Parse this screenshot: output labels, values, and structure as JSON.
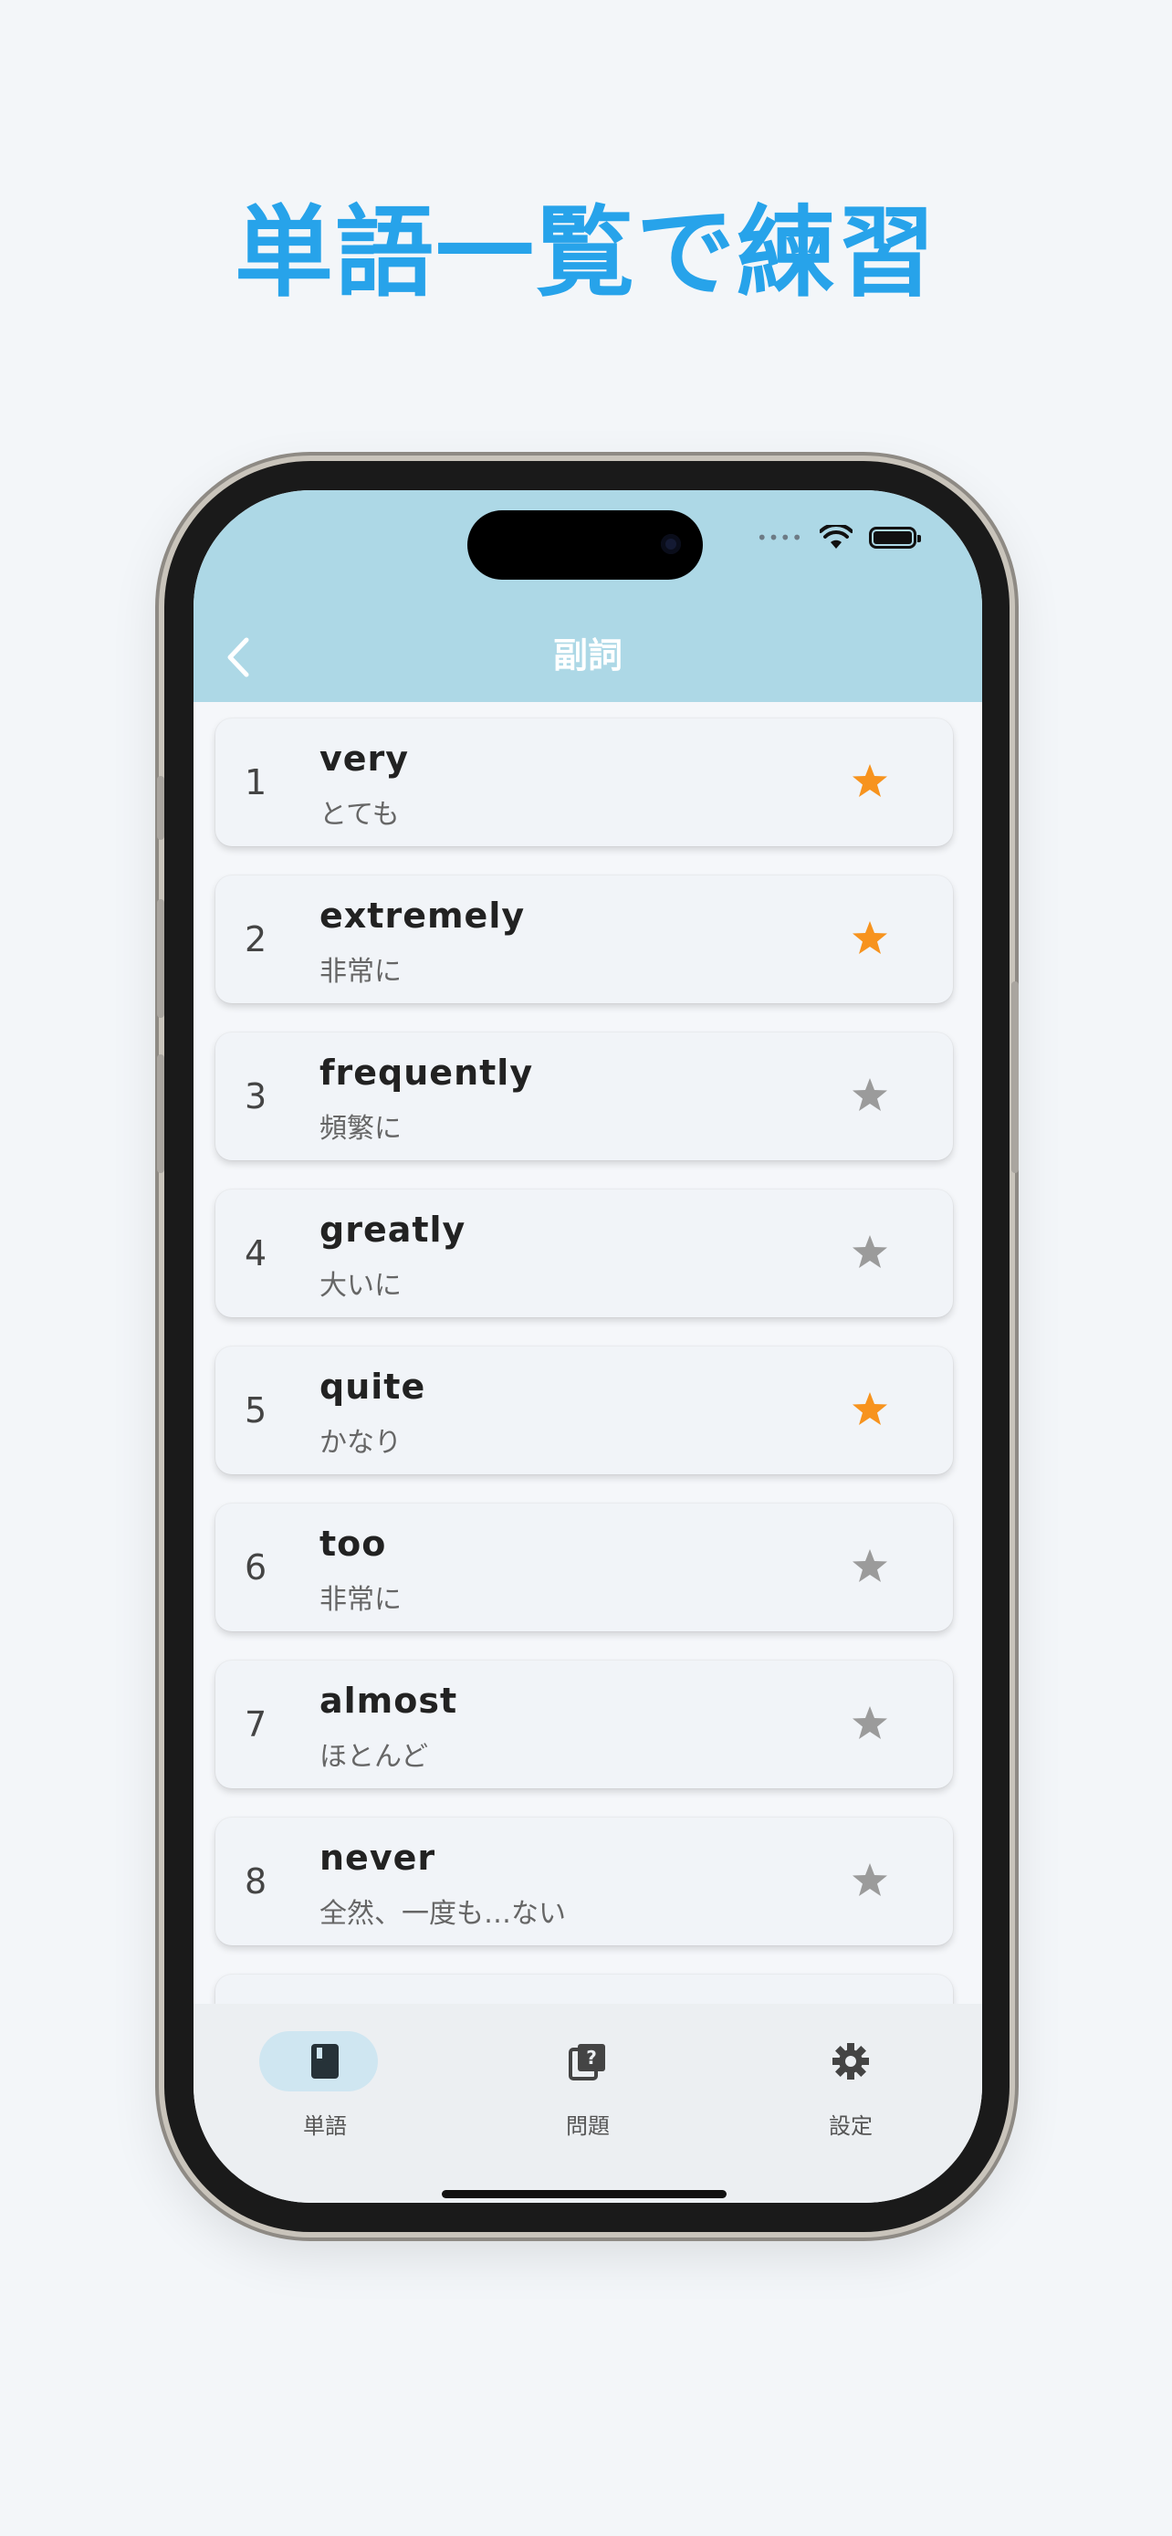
{
  "headline": "単語一覧で練習",
  "nav": {
    "title": "副詞"
  },
  "words": [
    {
      "num": "1",
      "word": "very",
      "meaning": "とても",
      "starred": true
    },
    {
      "num": "2",
      "word": "extremely",
      "meaning": "非常に",
      "starred": true
    },
    {
      "num": "3",
      "word": "frequently",
      "meaning": "頻繁に",
      "starred": false
    },
    {
      "num": "4",
      "word": "greatly",
      "meaning": "大いに",
      "starred": false
    },
    {
      "num": "5",
      "word": "quite",
      "meaning": "かなり",
      "starred": true
    },
    {
      "num": "6",
      "word": "too",
      "meaning": "非常に",
      "starred": false
    },
    {
      "num": "7",
      "word": "almost",
      "meaning": "ほとんど",
      "starred": false
    },
    {
      "num": "8",
      "word": "never",
      "meaning": "全然、一度も…ない",
      "starred": false
    }
  ],
  "tabs": [
    {
      "label": "単語",
      "icon": "book-icon",
      "active": true
    },
    {
      "label": "問題",
      "icon": "quiz-icon",
      "active": false
    },
    {
      "label": "設定",
      "icon": "gear-icon",
      "active": false
    }
  ],
  "colors": {
    "accent": "#27a3ea",
    "header": "#add8e6",
    "star_on": "#f7931e",
    "star_off": "#9b9b9b"
  }
}
